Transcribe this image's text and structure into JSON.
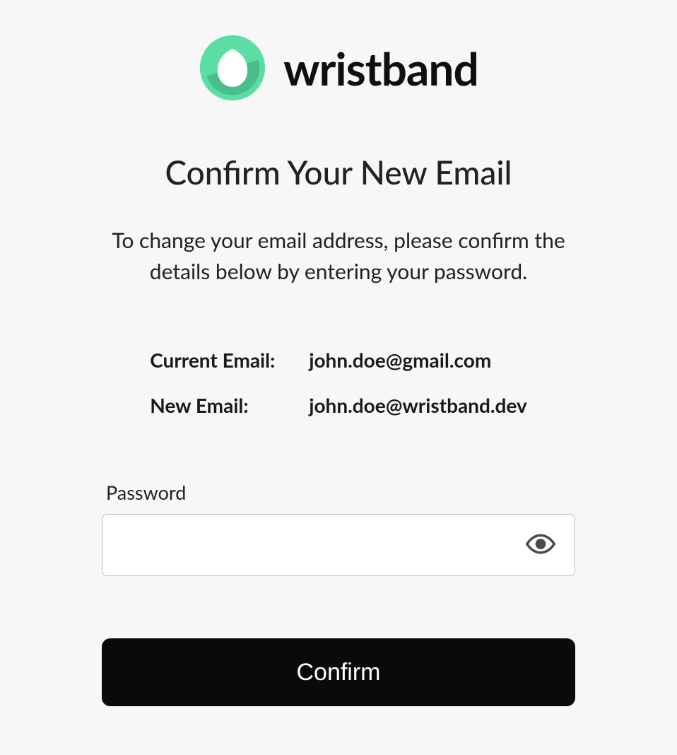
{
  "brand": {
    "name": "wristband"
  },
  "page": {
    "title": "Confirm Your New Email",
    "description": "To change your email address, please confirm the details below by entering your password."
  },
  "emails": {
    "current_label": "Current Email:",
    "current_value": "john.doe@gmail.com",
    "new_label": "New Email:",
    "new_value": "john.doe@wristband.dev"
  },
  "form": {
    "password_label": "Password",
    "password_value": "",
    "confirm_button": "Confirm"
  }
}
